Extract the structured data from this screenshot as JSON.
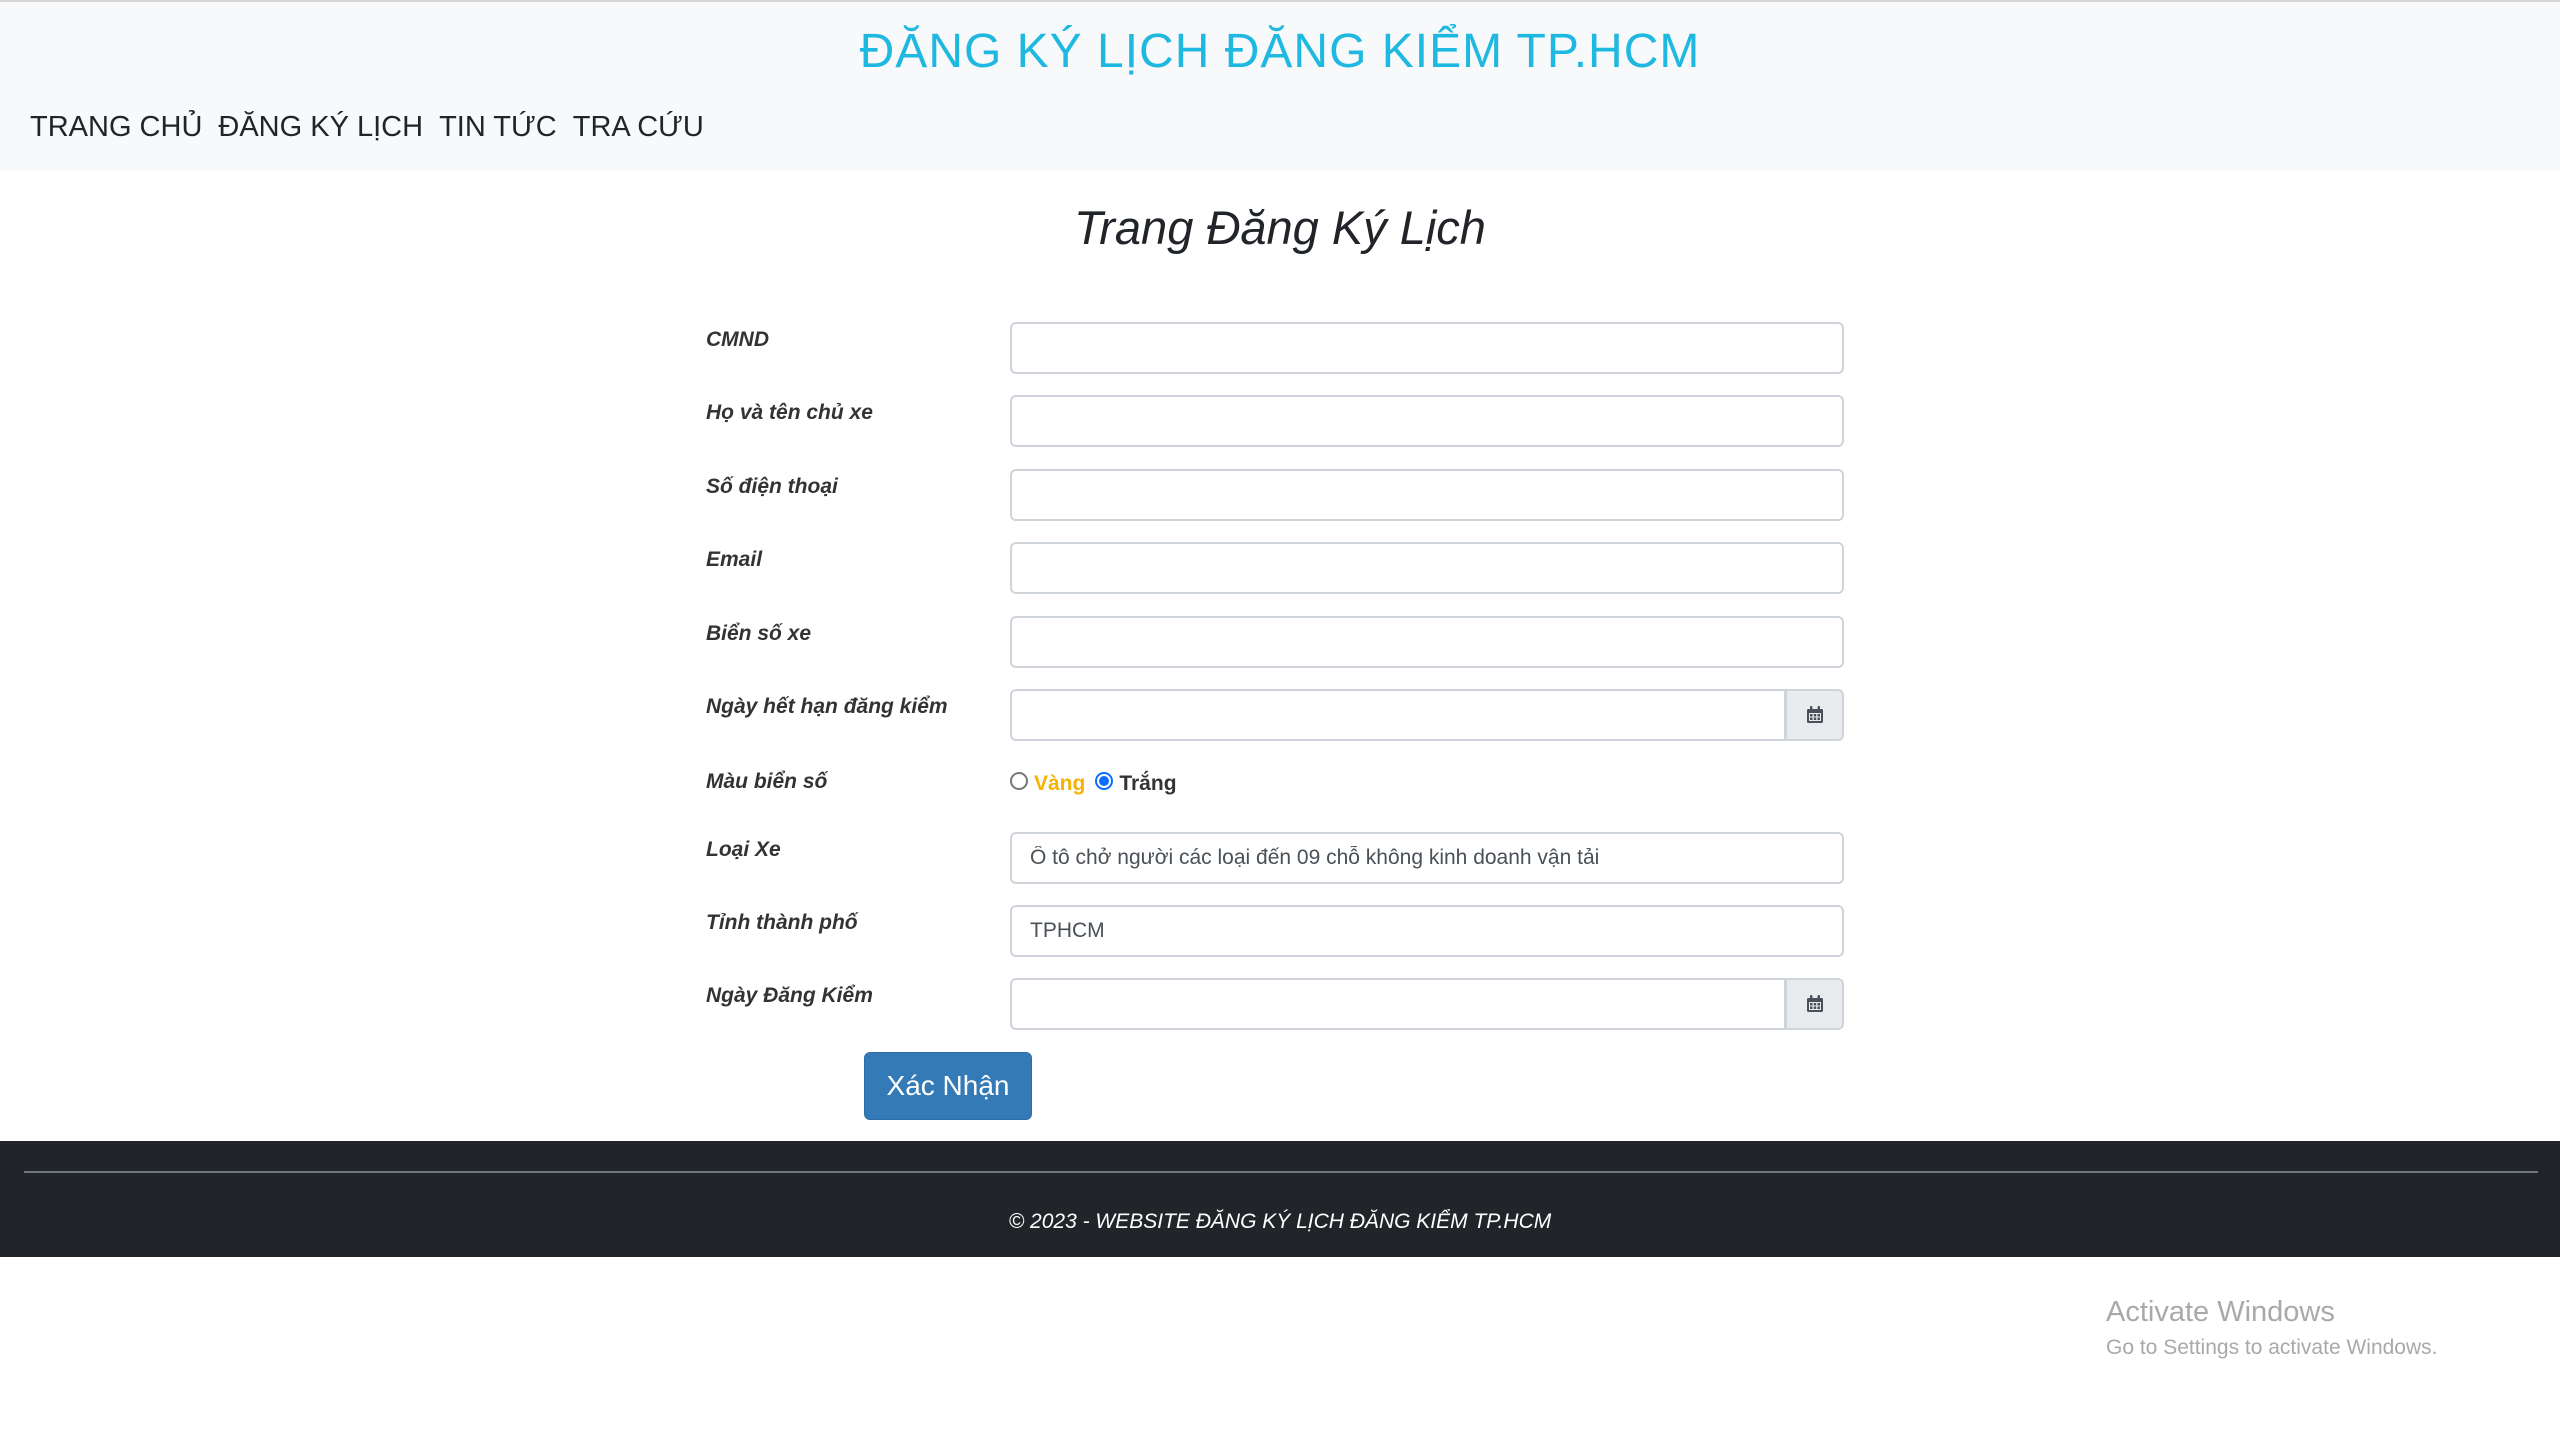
{
  "header": {
    "site_title": "ĐĂNG KÝ LỊCH ĐĂNG KIỂM TP.HCM",
    "nav": [
      {
        "label": "TRANG CHỦ"
      },
      {
        "label": "ĐĂNG KÝ LỊCH"
      },
      {
        "label": "TIN TỨC"
      },
      {
        "label": "TRA CỨU"
      }
    ]
  },
  "page": {
    "heading": "Trang Đăng Ký Lịch"
  },
  "form": {
    "cmnd": {
      "label": "CMND",
      "value": ""
    },
    "owner_name": {
      "label": "Họ và tên chủ xe",
      "value": ""
    },
    "phone": {
      "label": "Số điện thoại",
      "value": ""
    },
    "email": {
      "label": "Email",
      "value": ""
    },
    "plate": {
      "label": "Biển số xe",
      "value": ""
    },
    "expiry_date": {
      "label": "Ngày hết hạn đăng kiểm",
      "value": ""
    },
    "plate_color": {
      "label": "Màu biển số",
      "options": [
        {
          "label": "Vàng",
          "checked": false
        },
        {
          "label": "Trắng",
          "checked": true
        }
      ]
    },
    "vehicle_type": {
      "label": "Loại Xe",
      "value": "Ô tô chở người các loại đến 09 chỗ không kinh doanh vận tải"
    },
    "province": {
      "label": "Tỉnh thành phố",
      "value": "TPHCM"
    },
    "inspection_date": {
      "label": "Ngày Đăng Kiểm",
      "value": ""
    },
    "submit_label": "Xác Nhận"
  },
  "footer": {
    "text": "© 2023 - WEBSITE ĐĂNG KÝ LỊCH ĐĂNG KIỂM TP.HCM"
  },
  "watermark": {
    "title": "Activate Windows",
    "subtitle": "Go to Settings to activate Windows."
  },
  "colors": {
    "title": "#1fb8e0",
    "header_bg": "#f8f9fa",
    "footer_bg": "#212529",
    "button": "#337ab7",
    "yellow_option": "#f5b301"
  }
}
